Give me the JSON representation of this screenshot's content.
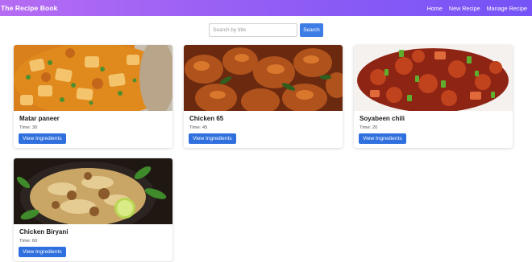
{
  "header": {
    "brand": "The Recipe Book",
    "nav": [
      {
        "label": "Home"
      },
      {
        "label": "New Recipe"
      },
      {
        "label": "Manage Recipe"
      }
    ]
  },
  "search": {
    "placeholder": "Search by title",
    "value": "",
    "button_label": "Search"
  },
  "recipes": [
    {
      "title": "Matar paneer",
      "time": "Time: 30",
      "button_label": "View Ingredients"
    },
    {
      "title": "Chicken 65",
      "time": "Time: 45",
      "button_label": "View Ingredients"
    },
    {
      "title": "Soyabeen chili",
      "time": "Time: 20",
      "button_label": "View Ingredients"
    },
    {
      "title": "Chicken Biryani",
      "time": "Time: 60",
      "button_label": "View Ingredients"
    }
  ],
  "colors": {
    "header_gradient_start": "#b66cf3",
    "header_gradient_end": "#7553f6",
    "primary_button": "#2f6fde"
  }
}
